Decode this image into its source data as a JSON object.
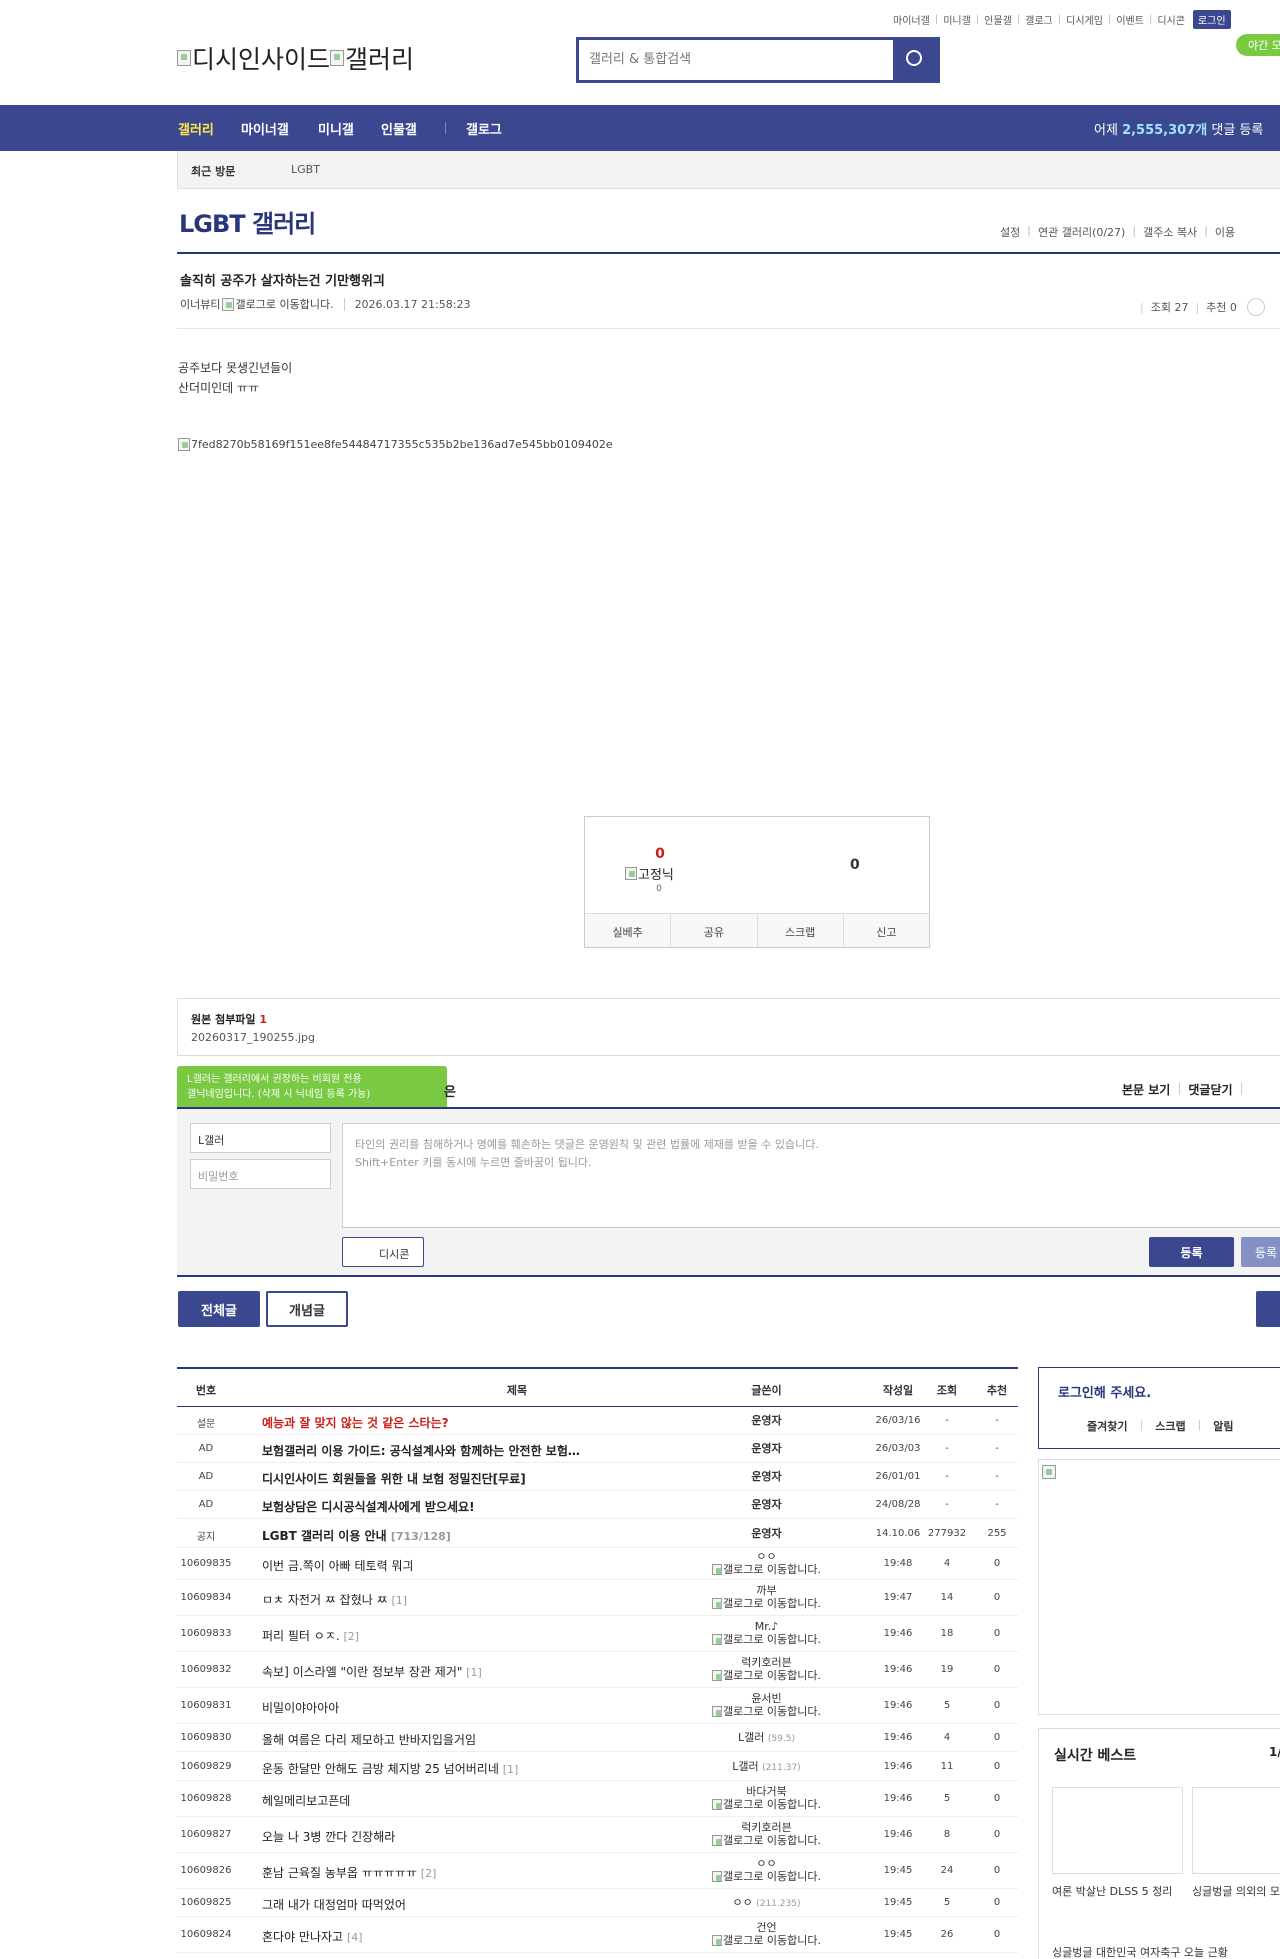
{
  "util_menu": [
    "마이너갤",
    "미니갤",
    "인물갤",
    "갤로그",
    "디시게임",
    "이벤트",
    "디시콘"
  ],
  "login_label": "로그인",
  "night_mode": "야간 모",
  "logo": {
    "alt1": "디시인사이드",
    "alt2": "갤러리"
  },
  "search": {
    "placeholder": "갤러리 & 통합검색"
  },
  "gnb": {
    "items": [
      "갤러리",
      "마이너갤",
      "미니갤",
      "인물갤",
      "갤로그"
    ],
    "yesterday_prefix": "어제",
    "yesterday_count": "2,555,307개",
    "yesterday_suffix": "댓글 등록"
  },
  "recent": {
    "label": "최근 방문",
    "gallery": "LGBT"
  },
  "gallery_title": "LGBT 갤러리",
  "gallery_menu": [
    "설정",
    "연관 갤러리(0/27)",
    "갤주소 복사",
    "이용"
  ],
  "post": {
    "title": "솔직히 공주가 살자하는건 기만행위긔",
    "author": "이너뷰티",
    "author_img_alt": "갤로그로 이동합니다.",
    "date": "2026.03.17 21:58:23",
    "views": "조회 27",
    "recommend": "추천 0",
    "body_lines": [
      "공주보다 못생긴년들이",
      "산더미인데 ㅠㅠ"
    ],
    "image_alt": "7fed8270b58169f151ee8fe54484717355c535b2be136ad7e545bb0109402e"
  },
  "rec_box": {
    "up": "0",
    "fix_alt": "고정닉",
    "fix_count": "0",
    "down": "0",
    "buttons": [
      "실베추",
      "공유",
      "스크랩",
      "신고"
    ]
  },
  "attach": {
    "label": "원본 첨부파일",
    "count": "1",
    "file": "20260317_190255.jpg"
  },
  "tooltip": [
    "L갤러는 갤러리에서 권장하는 비회원 전용",
    "갤닉네임입니다. (삭제 시 닉네임 등록 가능)"
  ],
  "tooltip_tail": "은",
  "comment": {
    "links": [
      "본문 보기",
      "댓글닫기"
    ],
    "nick": "L갤러",
    "pw_placeholder": "비밀번호",
    "placeholder1": "타인의 권리를 침해하거나 명예를 훼손하는 댓글은 운영원칙 및 관련 법률에 제재를 받을 수 있습니다.",
    "placeholder2": "Shift+Enter 키를 동시에 누르면 줄바꿈이 됩니다.",
    "dccon": "디시콘",
    "submit": "등록",
    "submit2": "등록"
  },
  "tabs": {
    "all": "전체글",
    "hot": "개념글"
  },
  "table": {
    "headers": [
      "번호",
      "제목",
      "글쓴이",
      "작성일",
      "조회",
      "추천"
    ],
    "rows": [
      {
        "no": "설문",
        "title": "예능과 잘 맞지 않는 것 같은 스타는?",
        "cnt": "",
        "writer": "운영자",
        "ip": "",
        "date": "26/03/16",
        "views": "-",
        "rec": "-"
      },
      {
        "no": "AD",
        "title": "보험갤러리 이용 가이드: 공식설계사와 함께하는 안전한 보험…",
        "cnt": "",
        "writer": "운영자",
        "ip": "",
        "date": "26/03/03",
        "views": "-",
        "rec": "-"
      },
      {
        "no": "AD",
        "title": "디시인사이드 회원들을 위한 내 보험 정밀진단[무료]",
        "cnt": "",
        "writer": "운영자",
        "ip": "",
        "date": "26/01/01",
        "views": "-",
        "rec": "-"
      },
      {
        "no": "AD",
        "title": "보험상담은 디시공식설계사에게 받으세요!",
        "cnt": "",
        "writer": "운영자",
        "ip": "",
        "date": "24/08/28",
        "views": "-",
        "rec": "-"
      },
      {
        "no": "공지",
        "title": "LGBT 갤러리 이용 안내",
        "cnt": "[713/128]",
        "writer": "운영자",
        "ip": "",
        "date": "14.10.06",
        "views": "277932",
        "rec": "255"
      },
      {
        "no": "10609835",
        "title": "이번 금.쪽이 아빠 테토력 뭐긔",
        "cnt": "",
        "writer": "ㅇㅇ",
        "ip": "",
        "date": "19:48",
        "views": "4",
        "rec": "0"
      },
      {
        "no": "10609834",
        "title": "ㅁㅊ 자전거 ㅉ 잡혔나 ㅉ",
        "cnt": "[1]",
        "writer": "까부",
        "ip": "",
        "date": "19:47",
        "views": "14",
        "rec": "0"
      },
      {
        "no": "10609833",
        "title": "퍼리 필터 ㅇㅈ.",
        "cnt": "[2]",
        "writer": "Mr.♪",
        "ip": "",
        "date": "19:46",
        "views": "18",
        "rec": "0"
      },
      {
        "no": "10609832",
        "title": "속보] 이스라엘 \"이란 정보부 장관 제거\"",
        "cnt": "[1]",
        "writer": "럭키호러븐",
        "ip": "",
        "date": "19:46",
        "views": "19",
        "rec": "0"
      },
      {
        "no": "10609831",
        "title": "비밀이야아아아",
        "cnt": "",
        "writer": "윤서빈",
        "ip": "",
        "date": "19:46",
        "views": "5",
        "rec": "0"
      },
      {
        "no": "10609830",
        "title": "올해 여름은 다리 제모하고 반바지입을거임",
        "cnt": "",
        "writer": "L갤러",
        "ip": "(59.5)",
        "date": "19:46",
        "views": "4",
        "rec": "0"
      },
      {
        "no": "10609829",
        "title": "운동 한달만 안해도 금방 체지방 25 넘어버리네",
        "cnt": "[1]",
        "writer": "L갤러",
        "ip": "(211.37)",
        "date": "19:46",
        "views": "11",
        "rec": "0"
      },
      {
        "no": "10609828",
        "title": "헤일메리보고픈데",
        "cnt": "",
        "writer": "바다거북",
        "ip": "",
        "date": "19:46",
        "views": "5",
        "rec": "0"
      },
      {
        "no": "10609827",
        "title": "오늘 나 3병 깐다 긴장해라",
        "cnt": "",
        "writer": "럭키호러븐",
        "ip": "",
        "date": "19:46",
        "views": "8",
        "rec": "0"
      },
      {
        "no": "10609826",
        "title": "훈남 근육질 농부옵 ㅠㅠㅠㅠㅠ",
        "cnt": "[2]",
        "writer": "ㅇㅇ",
        "ip": "",
        "date": "19:45",
        "views": "24",
        "rec": "0"
      },
      {
        "no": "10609825",
        "title": "그래 내가 대정엄마 따먹었어",
        "cnt": "",
        "writer": "ㅇㅇ",
        "ip": "(211.235)",
        "date": "19:45",
        "views": "5",
        "rec": "0"
      },
      {
        "no": "10609824",
        "title": "혼다야 만나자고",
        "cnt": "[4]",
        "writer": "건언",
        "ip": "",
        "date": "19:45",
        "views": "26",
        "rec": "0"
      }
    ],
    "gallog_alt": "갤로그로 이동합니다."
  },
  "sidebar": {
    "login_title": "로그인해 주세요.",
    "login_links": [
      "즐겨찾기",
      "스크랩",
      "알림"
    ],
    "best_title": "실시간 베스트",
    "best_page": "1/",
    "best_items": [
      "여론 박살난 DLSS 5 정리",
      "싱글벙글 의외의 모습이었던 우리나라 좌",
      "싱글벙글 대한민국 여자축구 오늘 근황"
    ]
  }
}
